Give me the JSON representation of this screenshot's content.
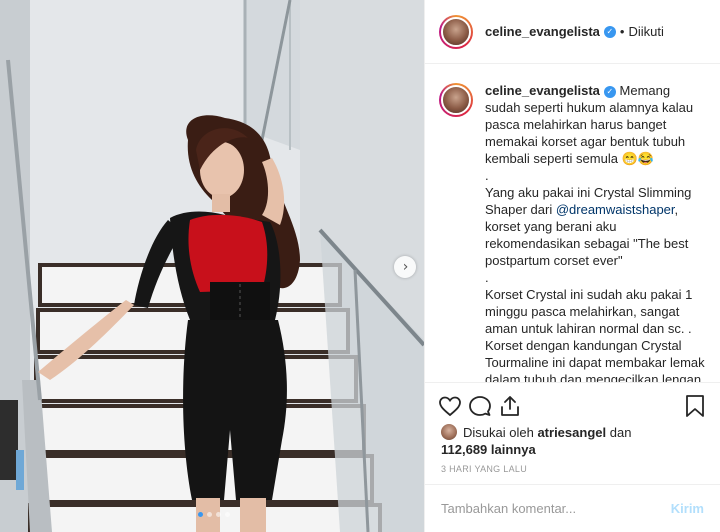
{
  "post": {
    "username": "celine_evangelista",
    "separator": "•",
    "follow_state": "Diikuti",
    "caption_lines": [
      "Memang sudah seperti hukum alamnya kalau pasca melahirkan harus banget memakai korset agar bentuk tubuh kembali seperti semula 😁😂",
      ".",
      "Yang aku pakai ini Crystal Slimming Shaper dari ",
      "korset yang berani aku rekomendasikan sebagai \"The best postpartum corset ever\"",
      ".",
      "Korset Crystal ini sudah aku pakai 1 minggu pasca melahirkan, sangat aman untuk lahiran normal dan sc. .",
      "Korset dengan kandungan Crystal Tourmaline ini dapat membakar lemak dalam tubuh dan mengecilkan lengan, perut, paha serta menaikkan bokong"
    ],
    "mention": "@dreamwaistshaper",
    "mention_suffix": ","
  },
  "likes": {
    "prefix": "Disukai oleh",
    "liker": "atriesangel",
    "joiner": "dan",
    "count": "112,689",
    "suffix": "lainnya"
  },
  "timestamp": "3 HARI YANG LALU",
  "comment": {
    "placeholder": "Tambahkan komentar...",
    "post_label": "Kirim"
  },
  "carousel": {
    "total": 4,
    "active_index": 0
  },
  "icons": [
    "heart-icon",
    "comment-icon",
    "share-icon",
    "bookmark-icon",
    "chevron-right-icon",
    "verified-icon"
  ],
  "colors": {
    "link": "#003569",
    "verified": "#3897f0",
    "dress_red": "#c8101b",
    "dress_black": "#141414"
  }
}
